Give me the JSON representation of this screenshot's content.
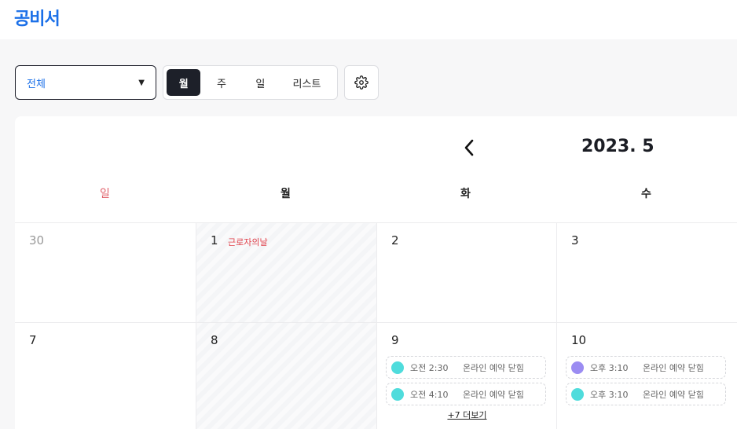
{
  "app": {
    "logo": "공비서"
  },
  "filter": {
    "value": "전체"
  },
  "view_toggle": {
    "month": "월",
    "week": "주",
    "day": "일",
    "list": "리스트",
    "active": "month"
  },
  "calendar": {
    "title": "2023. 5",
    "weekdays": [
      "일",
      "월",
      "화",
      "수"
    ],
    "weeks": [
      {
        "days": [
          {
            "num": "30",
            "muted": true
          },
          {
            "num": "1",
            "holiday": "근로자의날"
          },
          {
            "num": "2"
          },
          {
            "num": "3"
          }
        ]
      },
      {
        "days": [
          {
            "num": "7"
          },
          {
            "num": "8"
          },
          {
            "num": "9",
            "events": [
              {
                "time": "오전 2:30",
                "title": "온라인 예약 닫힘",
                "color": "#4fdcdc"
              },
              {
                "time": "오전 4:10",
                "title": "온라인 예약 닫힘",
                "color": "#4fdcdc"
              }
            ],
            "more": "+7 더보기"
          },
          {
            "num": "10",
            "events": [
              {
                "time": "오후 3:10",
                "title": "온라인 예약 닫힘",
                "color": "#9b8cf2"
              },
              {
                "time": "오후 3:10",
                "title": "온라인 예약 닫힘",
                "color": "#4fdcdc"
              }
            ]
          }
        ]
      }
    ]
  },
  "colors": {
    "brand": "#1a6fe8",
    "dark": "#1d2029",
    "sunday": "#e0606a",
    "holiday": "#e0404a",
    "event_teal": "#4fdcdc",
    "event_purple": "#9b8cf2"
  },
  "icons": {
    "filter_caret": "caret-down-icon",
    "settings": "gear-icon",
    "prev": "chevron-left-icon"
  }
}
